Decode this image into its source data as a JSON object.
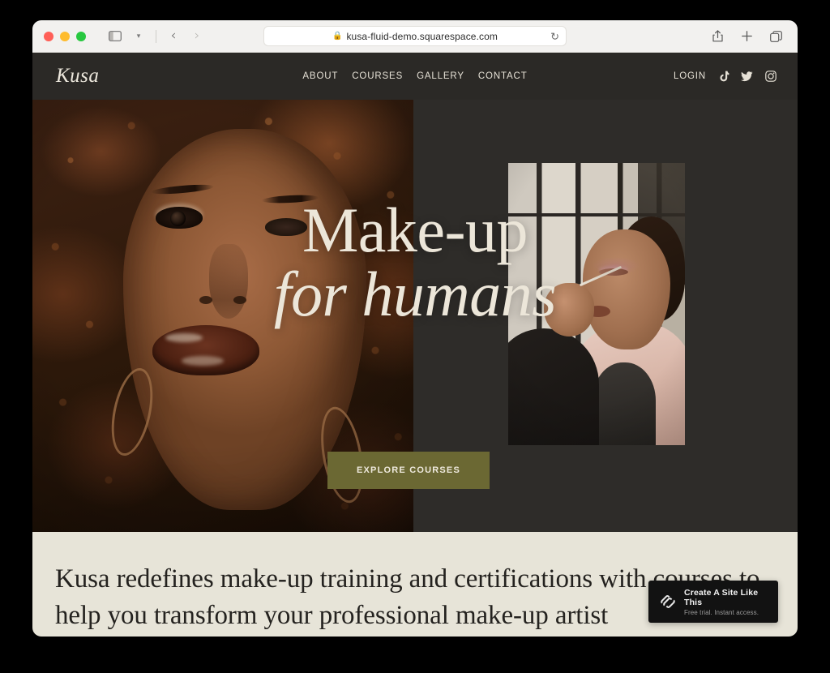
{
  "browser": {
    "url": "kusa-fluid-demo.squarespace.com",
    "lock_icon": "lock-icon",
    "reload_icon": "reload-icon",
    "sidebar_icon": "sidebar-toggle-icon",
    "chevron_icon": "chevron-down-icon",
    "back_icon": "back-arrow-icon",
    "forward_icon": "forward-arrow-icon",
    "share_icon": "share-icon",
    "new_tab_icon": "plus-icon",
    "tabs_icon": "tab-overview-icon",
    "traffic_lights": [
      "close",
      "minimize",
      "maximize"
    ]
  },
  "site": {
    "logo": "Kusa",
    "nav": [
      {
        "label": "ABOUT"
      },
      {
        "label": "COURSES"
      },
      {
        "label": "GALLERY"
      },
      {
        "label": "CONTACT"
      }
    ],
    "login_label": "LOGIN",
    "social": [
      {
        "name": "tiktok-icon"
      },
      {
        "name": "twitter-icon"
      },
      {
        "name": "instagram-icon"
      }
    ]
  },
  "hero": {
    "headline_line1": "Make-up",
    "headline_line2": "for humans",
    "cta_label": "EXPLORE COURSES",
    "background_color": "#2e2c29",
    "cta_color": "#6b6833",
    "text_color": "#ece6d9"
  },
  "intro": {
    "paragraph": "Kusa redefines make-up training and certifications with courses to help you transform your professional make-up artist",
    "background_color": "#e7e4d8",
    "text_color": "#24221f"
  },
  "badge": {
    "title": "Create A Site Like This",
    "subtitle": "Free trial. Instant access.",
    "logo_icon": "squarespace-logo-icon"
  }
}
